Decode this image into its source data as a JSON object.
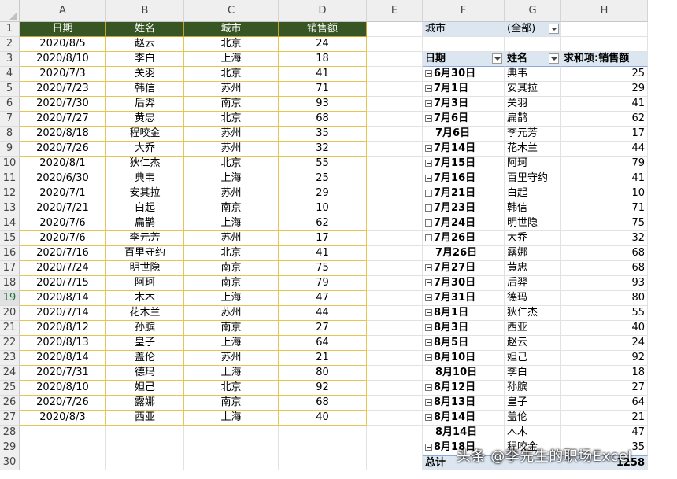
{
  "columns": [
    "A",
    "B",
    "C",
    "D",
    "E",
    "F",
    "G",
    "H"
  ],
  "rows": [
    "1",
    "2",
    "3",
    "4",
    "5",
    "6",
    "7",
    "8",
    "9",
    "10",
    "11",
    "12",
    "13",
    "14",
    "15",
    "16",
    "17",
    "18",
    "19",
    "20",
    "21",
    "22",
    "23",
    "24",
    "25",
    "26",
    "27",
    "28",
    "29",
    "30"
  ],
  "source_table": {
    "headers": [
      "日期",
      "姓名",
      "城市",
      "销售额"
    ],
    "rows": [
      [
        "2020/8/5",
        "赵云",
        "北京",
        "24"
      ],
      [
        "2020/8/10",
        "李白",
        "上海",
        "18"
      ],
      [
        "2020/7/3",
        "关羽",
        "北京",
        "41"
      ],
      [
        "2020/7/23",
        "韩信",
        "苏州",
        "71"
      ],
      [
        "2020/7/30",
        "后羿",
        "南京",
        "93"
      ],
      [
        "2020/7/27",
        "黄忠",
        "北京",
        "68"
      ],
      [
        "2020/8/18",
        "程咬金",
        "苏州",
        "35"
      ],
      [
        "2020/7/26",
        "大乔",
        "苏州",
        "32"
      ],
      [
        "2020/8/1",
        "狄仁杰",
        "北京",
        "55"
      ],
      [
        "2020/6/30",
        "典韦",
        "上海",
        "25"
      ],
      [
        "2020/7/1",
        "安其拉",
        "苏州",
        "29"
      ],
      [
        "2020/7/21",
        "白起",
        "南京",
        "10"
      ],
      [
        "2020/7/6",
        "扁鹊",
        "上海",
        "62"
      ],
      [
        "2020/7/6",
        "李元芳",
        "苏州",
        "17"
      ],
      [
        "2020/7/16",
        "百里守约",
        "北京",
        "41"
      ],
      [
        "2020/7/24",
        "明世隐",
        "南京",
        "75"
      ],
      [
        "2020/7/15",
        "阿珂",
        "南京",
        "79"
      ],
      [
        "2020/8/14",
        "木木",
        "上海",
        "47"
      ],
      [
        "2020/7/14",
        "花木兰",
        "苏州",
        "44"
      ],
      [
        "2020/8/12",
        "孙膑",
        "南京",
        "27"
      ],
      [
        "2020/8/13",
        "皇子",
        "上海",
        "64"
      ],
      [
        "2020/8/14",
        "盖伦",
        "苏州",
        "21"
      ],
      [
        "2020/7/31",
        "德玛",
        "上海",
        "80"
      ],
      [
        "2020/8/10",
        "妲己",
        "北京",
        "92"
      ],
      [
        "2020/7/26",
        "露娜",
        "南京",
        "68"
      ],
      [
        "2020/8/3",
        "西亚",
        "上海",
        "40"
      ]
    ]
  },
  "pivot": {
    "filter_label": "城市",
    "filter_value": "(全部)",
    "headers": [
      "日期",
      "姓名",
      "求和项:销售额"
    ],
    "rows": [
      {
        "date": "6月30日",
        "expand": true,
        "name": "典韦",
        "value": "25"
      },
      {
        "date": "7月1日",
        "expand": true,
        "name": "安其拉",
        "value": "29"
      },
      {
        "date": "7月3日",
        "expand": true,
        "name": "关羽",
        "value": "41"
      },
      {
        "date": "7月6日",
        "expand": true,
        "name": "扁鹊",
        "value": "62"
      },
      {
        "date": "7月6日",
        "expand": false,
        "name": "李元芳",
        "value": "17"
      },
      {
        "date": "7月14日",
        "expand": true,
        "name": "花木兰",
        "value": "44"
      },
      {
        "date": "7月15日",
        "expand": true,
        "name": "阿珂",
        "value": "79"
      },
      {
        "date": "7月16日",
        "expand": true,
        "name": "百里守约",
        "value": "41"
      },
      {
        "date": "7月21日",
        "expand": true,
        "name": "白起",
        "value": "10"
      },
      {
        "date": "7月23日",
        "expand": true,
        "name": "韩信",
        "value": "71"
      },
      {
        "date": "7月24日",
        "expand": true,
        "name": "明世隐",
        "value": "75"
      },
      {
        "date": "7月26日",
        "expand": true,
        "name": "大乔",
        "value": "32"
      },
      {
        "date": "7月26日",
        "expand": false,
        "name": "露娜",
        "value": "68"
      },
      {
        "date": "7月27日",
        "expand": true,
        "name": "黄忠",
        "value": "68"
      },
      {
        "date": "7月30日",
        "expand": true,
        "name": "后羿",
        "value": "93"
      },
      {
        "date": "7月31日",
        "expand": true,
        "name": "德玛",
        "value": "80"
      },
      {
        "date": "8月1日",
        "expand": true,
        "name": "狄仁杰",
        "value": "55"
      },
      {
        "date": "8月3日",
        "expand": true,
        "name": "西亚",
        "value": "40"
      },
      {
        "date": "8月5日",
        "expand": true,
        "name": "赵云",
        "value": "24"
      },
      {
        "date": "8月10日",
        "expand": true,
        "name": "妲己",
        "value": "92"
      },
      {
        "date": "8月10日",
        "expand": false,
        "name": "李白",
        "value": "18"
      },
      {
        "date": "8月12日",
        "expand": true,
        "name": "孙膑",
        "value": "27"
      },
      {
        "date": "8月13日",
        "expand": true,
        "name": "皇子",
        "value": "64"
      },
      {
        "date": "8月14日",
        "expand": true,
        "name": "盖伦",
        "value": "21"
      },
      {
        "date": "8月14日",
        "expand": false,
        "name": "木木",
        "value": "47"
      },
      {
        "date": "8月18日",
        "expand": true,
        "name": "程咬金",
        "value": "35"
      }
    ],
    "total_label": "总计",
    "total_value": "1258"
  },
  "watermark": "头条 @李先生的职场Excel",
  "colors": {
    "header_green": "#375623",
    "data_border": "#e6c550",
    "pivot_blue": "#dce6f1"
  }
}
